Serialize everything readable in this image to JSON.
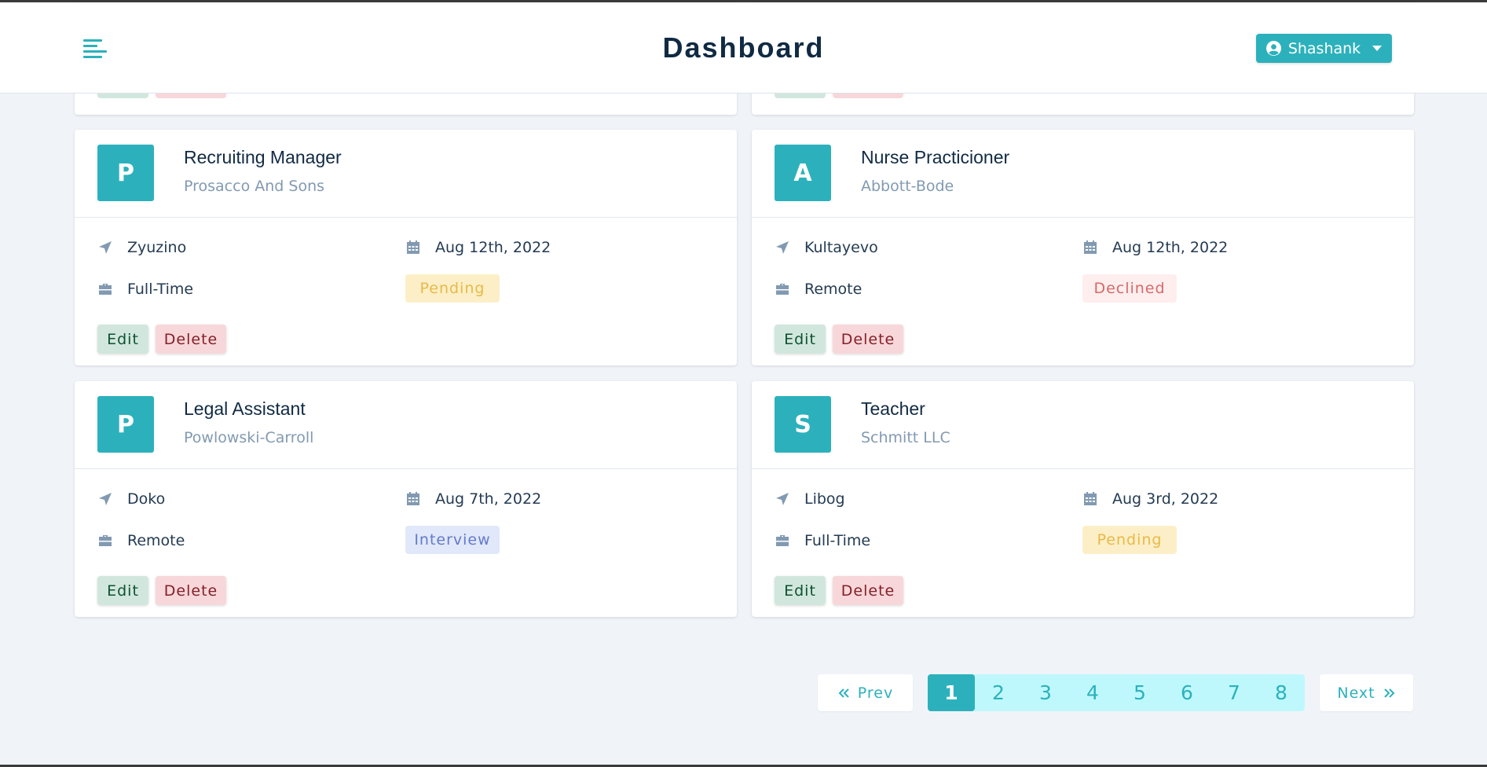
{
  "navbar": {
    "title": "Dashboard",
    "user_label": "Shashank"
  },
  "jobs": [
    {
      "initial": "P",
      "position": "Recruiting Manager",
      "company": "Prosacco And Sons",
      "location": "Zyuzino",
      "date": "Aug 12th, 2022",
      "type": "Full-Time",
      "status": "Pending"
    },
    {
      "initial": "A",
      "position": "Nurse Practicioner",
      "company": "Abbott-Bode",
      "location": "Kultayevo",
      "date": "Aug 12th, 2022",
      "type": "Remote",
      "status": "Declined"
    },
    {
      "initial": "P",
      "position": "Legal Assistant",
      "company": "Powlowski-Carroll",
      "location": "Doko",
      "date": "Aug 7th, 2022",
      "type": "Remote",
      "status": "Interview"
    },
    {
      "initial": "S",
      "position": "Teacher",
      "company": "Schmitt LLC",
      "location": "Libog",
      "date": "Aug 3rd, 2022",
      "type": "Full-Time",
      "status": "Pending"
    }
  ],
  "actions": {
    "edit_label": "Edit",
    "delete_label": "Delete"
  },
  "pagination": {
    "prev_label": "Prev",
    "next_label": "Next",
    "pages": [
      "1",
      "2",
      "3",
      "4",
      "5",
      "6",
      "7",
      "8"
    ],
    "current": "1"
  },
  "colors": {
    "primary": "#2cb1bc",
    "pending_bg": "#fcefc7",
    "pending_text": "#e9b949",
    "declined_bg": "#ffeeee",
    "declined_text": "#d66a6a",
    "interview_bg": "#e0e8f9",
    "interview_text": "#647acb"
  }
}
